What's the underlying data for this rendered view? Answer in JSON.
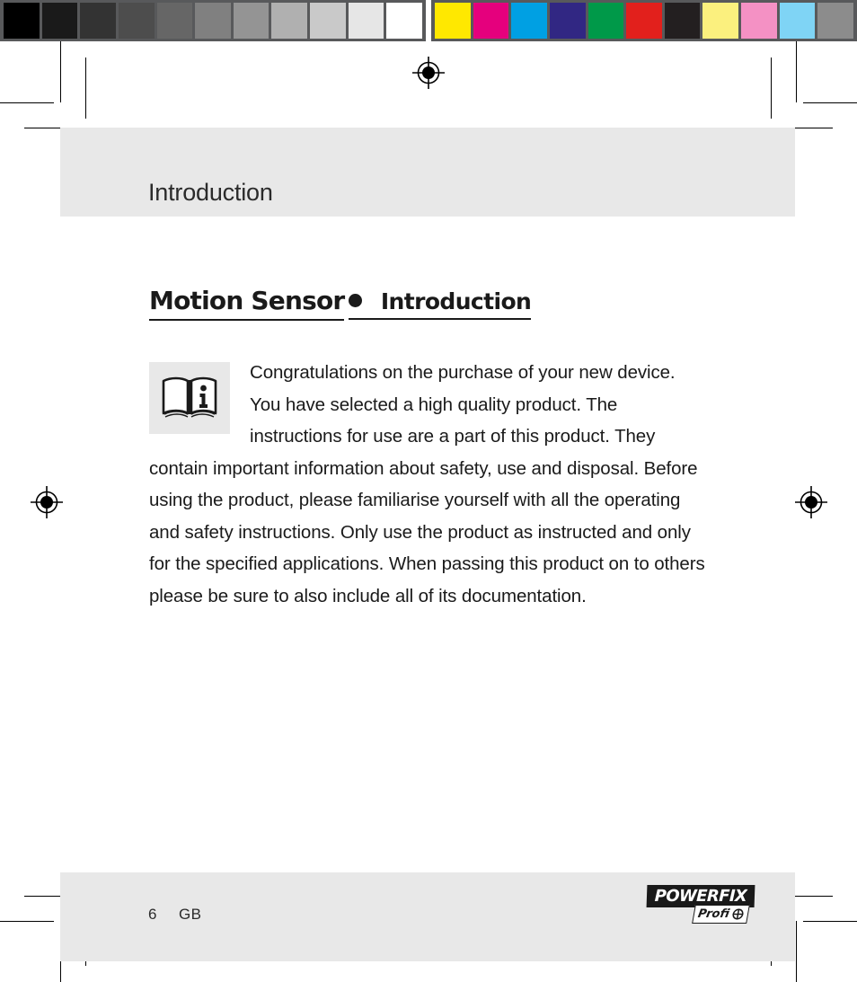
{
  "calibration": {
    "grayscale_label": "grayscale-step-wedge",
    "grayscale_patches": [
      "#000000",
      "#1a1a1a",
      "#333333",
      "#4d4d4d",
      "#666666",
      "#808080",
      "#949494",
      "#b0b0b0",
      "#c9c9c9",
      "#e6e6e6",
      "#ffffff"
    ],
    "color_label": "process-color-patches",
    "color_patches": [
      "#ffe800",
      "#e5007d",
      "#00a0e3",
      "#312783",
      "#009949",
      "#e2201c",
      "#231f20",
      "#fbf07e",
      "#f491c4",
      "#7fd4f5",
      "#8c8c8c"
    ],
    "strip_background": "#58595b"
  },
  "header": {
    "running_title": "Introduction"
  },
  "content": {
    "product_title": "Motion Sensor",
    "section_bullet": "bullet-dot",
    "section_heading": "Introduction",
    "book_icon_name": "open-book-information-icon",
    "intro_paragraph": "Congratulations on the purchase of your new device. You have selected a high quality product. The instructions for use are a part of this product. They contain important information about safety, use and disposal. Before using the product, please familiarise yourself with all the operating and safety instructions. Only use the product as instructed and only for the specified applications. When passing this product on to others please be sure to also include all of its documentation."
  },
  "footer": {
    "page_number": "6",
    "locale": "GB",
    "brand": {
      "wordmark": "POWERFIX",
      "registered_mark": "®",
      "sub_wordmark": "Profi",
      "sub_mark_name": "crosshair-target-icon"
    }
  },
  "prepress": {
    "registration_target_name": "registration-target-mark",
    "crop_mark_name": "crop-mark",
    "page_background": "#ffffff",
    "band_background": "#e8e8e8"
  }
}
